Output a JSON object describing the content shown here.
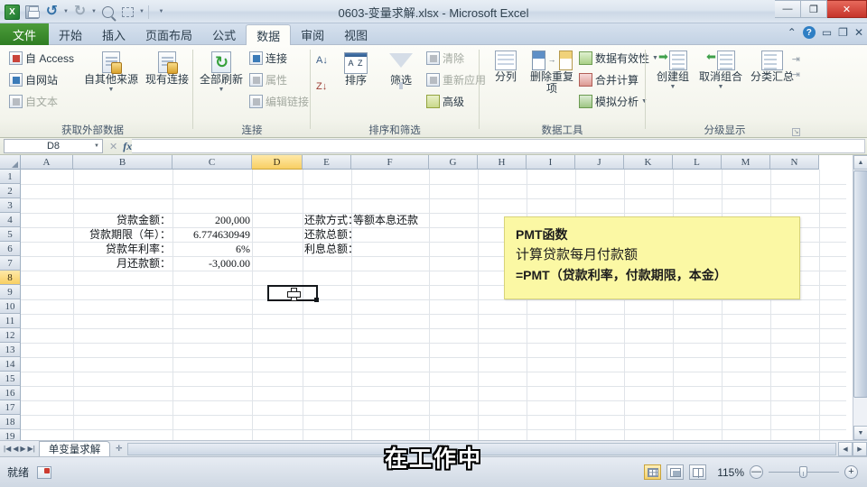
{
  "window": {
    "title": "0603-变量求解.xlsx - Microsoft Excel",
    "minimize": "—",
    "restore": "❐",
    "close": "✕"
  },
  "quick_access": {
    "items": [
      {
        "name": "excel-logo-icon",
        "label": "X"
      },
      {
        "name": "save-icon",
        "label": ""
      },
      {
        "name": "undo-icon",
        "label": "↺"
      },
      {
        "name": "redo-icon",
        "label": "↻"
      },
      {
        "name": "print-preview-icon",
        "label": ""
      },
      {
        "name": "quick-print-icon",
        "label": ""
      },
      {
        "name": "customize-qat-icon",
        "label": "▾"
      }
    ]
  },
  "ribbon_tabs": {
    "file": "文件",
    "items": [
      {
        "label": "开始",
        "active": false
      },
      {
        "label": "插入",
        "active": false
      },
      {
        "label": "页面布局",
        "active": false
      },
      {
        "label": "公式",
        "active": false
      },
      {
        "label": "数据",
        "active": true
      },
      {
        "label": "审阅",
        "active": false
      },
      {
        "label": "视图",
        "active": false
      }
    ],
    "right_icons": [
      "collapse-ribbon-icon",
      "help-icon",
      "minimize-window-icon",
      "restore-window-icon",
      "close-window-icon"
    ]
  },
  "ribbon": {
    "groups": [
      {
        "name": "获取外部数据",
        "small_buttons": [
          "自 Access",
          "自网站",
          "自文本"
        ],
        "big_buttons": [
          "自其他来源",
          "现有连接"
        ]
      },
      {
        "name": "连接",
        "big_buttons": [
          "全部刷新"
        ],
        "small_buttons": [
          "连接",
          "属性",
          "编辑链接"
        ]
      },
      {
        "name": "排序和筛选",
        "big_buttons": [
          "排序",
          "筛选"
        ],
        "small_buttons": [
          "清除",
          "重新应用",
          "高级"
        ]
      },
      {
        "name": "数据工具",
        "big_buttons": [
          "分列",
          "删除重复项"
        ],
        "small_buttons": [
          "数据有效性",
          "合并计算",
          "模拟分析"
        ]
      },
      {
        "name": "分级显示",
        "big_buttons": [
          "创建组",
          "取消组合",
          "分类汇总"
        ]
      }
    ]
  },
  "formula_bar": {
    "name_box": "D8",
    "formula_value": "",
    "fx_label": "fx",
    "cancel_icon": "✕",
    "confirm_icon": "✓"
  },
  "grid": {
    "columns": [
      "A",
      "B",
      "C",
      "D",
      "E",
      "F",
      "G",
      "H",
      "I",
      "J",
      "K",
      "L",
      "M",
      "N"
    ],
    "selected_column": "D",
    "rows": [
      "1",
      "2",
      "3",
      "4",
      "5",
      "6",
      "7",
      "8",
      "9",
      "10",
      "11",
      "12",
      "13",
      "14",
      "15",
      "16",
      "17",
      "18",
      "19"
    ],
    "selected_row": "8",
    "selected_cell": "D8",
    "cells": [
      {
        "ref": "B4",
        "col": "B",
        "row": 4,
        "value": "贷款金额：",
        "align": "right"
      },
      {
        "ref": "C4",
        "col": "C",
        "row": 4,
        "value": "200,000",
        "align": "right"
      },
      {
        "ref": "B5",
        "col": "B",
        "row": 5,
        "value": "贷款期限（年）：",
        "align": "right"
      },
      {
        "ref": "C5",
        "col": "C",
        "row": 5,
        "value": "6.774630949",
        "align": "right"
      },
      {
        "ref": "B6",
        "col": "B",
        "row": 6,
        "value": "贷款年利率：",
        "align": "right"
      },
      {
        "ref": "C6",
        "col": "C",
        "row": 6,
        "value": "6%",
        "align": "right"
      },
      {
        "ref": "B7",
        "col": "B",
        "row": 7,
        "value": "月还款额：",
        "align": "right"
      },
      {
        "ref": "C7",
        "col": "C",
        "row": 7,
        "value": "-3,000.00",
        "align": "right"
      },
      {
        "ref": "E4",
        "col": "E",
        "row": 4,
        "value": "还款方式：",
        "align": "left"
      },
      {
        "ref": "F4",
        "col": "F",
        "row": 4,
        "value": "等额本息还款",
        "align": "left"
      },
      {
        "ref": "E5",
        "col": "E",
        "row": 5,
        "value": "还款总额：",
        "align": "left"
      },
      {
        "ref": "E6",
        "col": "E",
        "row": 6,
        "value": "利息总额：",
        "align": "left"
      }
    ]
  },
  "note": {
    "lines": [
      "PMT函数",
      "计算贷款每月付款额",
      "=PMT（贷款利率，付款期限，本金）"
    ],
    "background": "#fbf8a4"
  },
  "sheet_tabs": {
    "nav_first": "|◀",
    "nav_prev": "◀",
    "nav_next": "▶",
    "nav_last": "▶|",
    "tabs": [
      "单变量求解"
    ],
    "insert_sheet": "✛"
  },
  "status_bar": {
    "state": "就绪",
    "macro_record": "record-macro-icon",
    "views": [
      "normal-view",
      "page-layout-view",
      "page-break-view"
    ],
    "active_view": "normal-view",
    "zoom": "115%",
    "zoom_out": "—",
    "zoom_in": "+"
  },
  "caption": {
    "text": "在工作中"
  },
  "colors": {
    "file_tab": "#2f7d23",
    "close_button": "#c5332a",
    "selection_header": "#f8cf63",
    "note_yellow": "#fbf8a4"
  }
}
